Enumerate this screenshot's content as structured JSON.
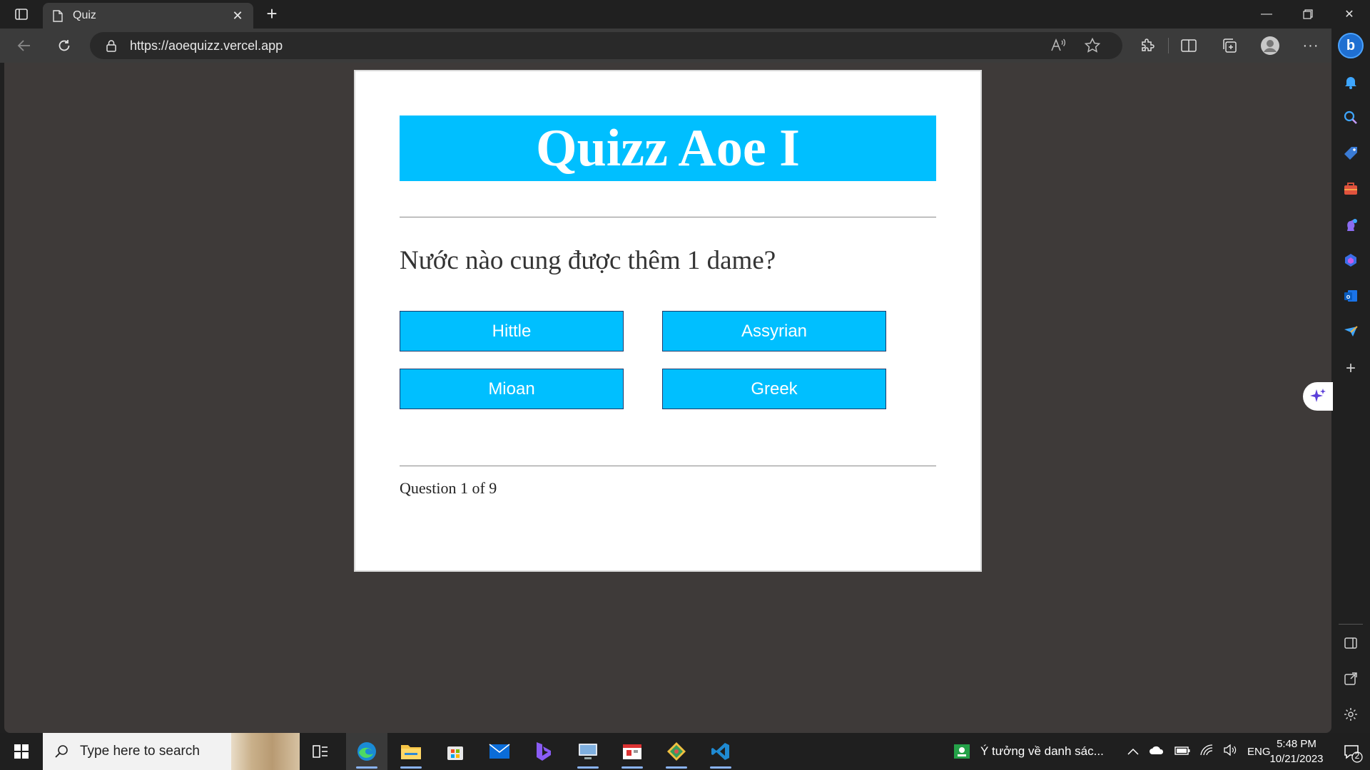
{
  "browser": {
    "tab_title": "Quiz",
    "url": "https://aoequizz.vercel.app"
  },
  "quiz": {
    "title": "Quizz Aoe I",
    "question": "Nước nào cung được thêm 1 dame?",
    "answers": [
      "Hittle",
      "Assyrian",
      "Mioan",
      "Greek"
    ],
    "progress": "Question 1 of 9",
    "accent_color": "#00bfff"
  },
  "taskbar": {
    "search_placeholder": "Type here to search",
    "notification_text": "Ý tưởng về danh sác...",
    "language": "ENG",
    "time": "5:48 PM",
    "date": "10/21/2023",
    "notification_count": "2"
  }
}
